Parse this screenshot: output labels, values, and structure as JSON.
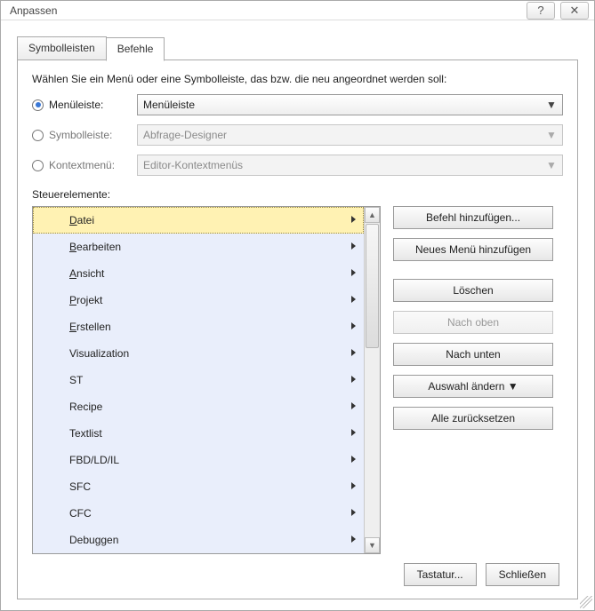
{
  "title": "Anpassen",
  "tabs": {
    "toolbars": "Symbolleisten",
    "commands": "Befehle"
  },
  "intro": "Wählen Sie ein Menü oder eine Symbolleiste, das bzw. die neu angeordnet werden soll:",
  "options": {
    "menubar": {
      "label": "Menüleiste:",
      "value": "Menüleiste"
    },
    "toolbar": {
      "label": "Symbolleiste:",
      "value": "Abfrage-Designer"
    },
    "context": {
      "label": "Kontextmenü:",
      "value": "Editor-Kontextmenüs"
    }
  },
  "controls_label": "Steuerelemente:",
  "items": [
    {
      "label": "Datei",
      "selected": true,
      "ul_index": 0
    },
    {
      "label": "Bearbeiten",
      "selected": false,
      "ul_index": 0
    },
    {
      "label": "Ansicht",
      "selected": false,
      "ul_index": 0
    },
    {
      "label": "Projekt",
      "selected": false,
      "ul_index": 0
    },
    {
      "label": "Erstellen",
      "selected": false,
      "ul_index": 0
    },
    {
      "label": "Visualization",
      "selected": false,
      "ul_index": -1
    },
    {
      "label": "ST",
      "selected": false,
      "ul_index": -1
    },
    {
      "label": "Recipe",
      "selected": false,
      "ul_index": -1
    },
    {
      "label": "Textlist",
      "selected": false,
      "ul_index": -1
    },
    {
      "label": "FBD/LD/IL",
      "selected": false,
      "ul_index": -1
    },
    {
      "label": "SFC",
      "selected": false,
      "ul_index": -1
    },
    {
      "label": "CFC",
      "selected": false,
      "ul_index": -1
    },
    {
      "label": "Debuggen",
      "selected": false,
      "ul_index": -1
    }
  ],
  "buttons": {
    "add_command": "Befehl hinzufügen...",
    "add_menu": "Neues Menü hinzufügen",
    "delete": "Löschen",
    "move_up": "Nach oben",
    "move_down": "Nach unten",
    "change_sel": "Auswahl ändern ▼",
    "reset_all": "Alle zurücksetzen"
  },
  "footer": {
    "keyboard": "Tastatur...",
    "close": "Schließen"
  }
}
